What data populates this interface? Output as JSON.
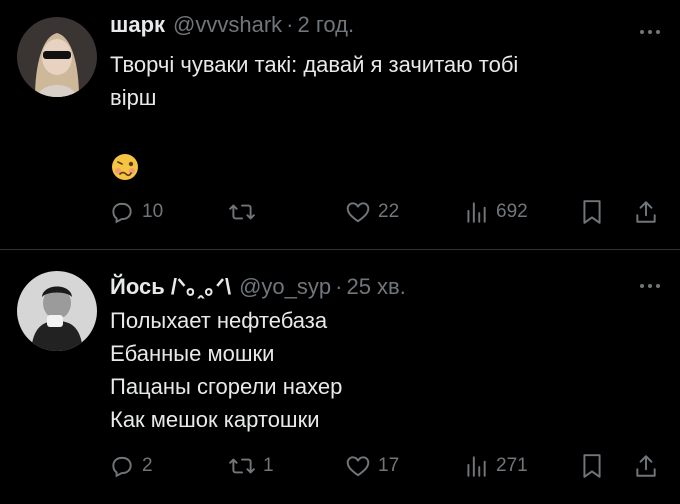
{
  "tweets": [
    {
      "name": "шарк",
      "handle": "@vvvshark",
      "time": "2 год.",
      "lines": [
        "Творчі чуваки такі: давай я зачитаю тобі",
        "вірш"
      ],
      "emoji": "woozy-face",
      "replies": "10",
      "retweets": "",
      "likes": "22",
      "views": "692"
    },
    {
      "name": "Йось /ᐠ｡ꞈ｡ᐟ\\",
      "handle": "@yo_syp",
      "time": "25 хв.",
      "lines": [
        "Полыхает нефтебаза",
        "Ебанные мошки",
        "Пацаны сгорели нахер",
        "Как мешок картошки"
      ],
      "replies": "2",
      "retweets": "1",
      "likes": "17",
      "views": "271"
    }
  ],
  "separator": "·",
  "colors": {
    "background": "#000000",
    "text": "#e7e9ea",
    "muted": "#71767b",
    "divider": "#2f3336"
  }
}
